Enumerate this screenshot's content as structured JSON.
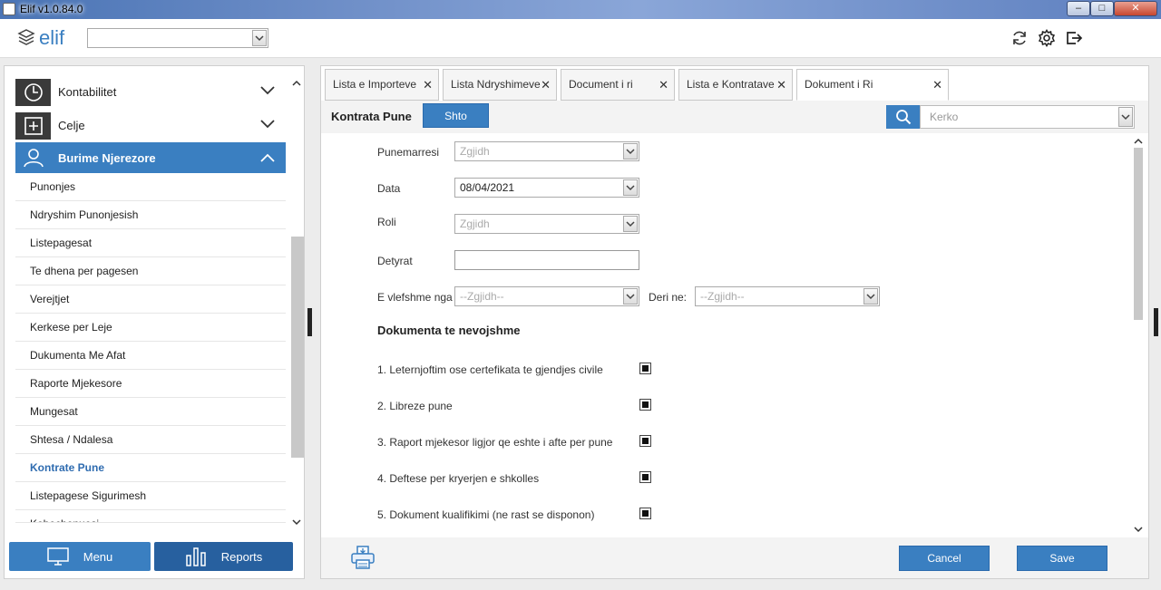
{
  "window": {
    "title": "Elif v1.0.84.0",
    "min": "–",
    "max": "□",
    "close": "✕"
  },
  "header": {
    "logo_text": "elif",
    "company_select": ""
  },
  "sidebar": {
    "groups": [
      {
        "label": "Kontabilitet",
        "icon": "clock-icon",
        "expanded": false
      },
      {
        "label": "Celje",
        "icon": "plus-box-icon",
        "expanded": false
      },
      {
        "label": "Burime Njerezore",
        "icon": "user-icon",
        "expanded": true
      }
    ],
    "items": [
      "Punonjes",
      "Ndryshim Punonjesish",
      "Listepagesat",
      "Te dhena per pagesen",
      "Verejtjet",
      "Kerkese per Leje",
      "Dukumenta Me Afat",
      "Raporte Mjekesore",
      "Mungesat",
      "Shtesa / Ndalesa",
      "Kontrate Pune",
      "Listepagese Sigurimesh",
      "Kohechenuesi"
    ],
    "current_item": "Kontrate Pune",
    "menu_label": "Menu",
    "reports_label": "Reports"
  },
  "tabs": [
    {
      "label": "Lista e Importeve",
      "active": false
    },
    {
      "label": "Lista Ndryshimeve",
      "active": false
    },
    {
      "label": "Document i ri",
      "active": false
    },
    {
      "label": "Lista e Kontratave",
      "active": false
    },
    {
      "label": "Dokument i Ri",
      "active": true
    }
  ],
  "toolbar": {
    "title": "Kontrata Pune",
    "add_label": "Shto",
    "search_placeholder": "Kerko"
  },
  "form": {
    "employee_label": "Punemarresi",
    "employee_value": "Zgjidh",
    "date_label": "Data",
    "date_value": "08/04/2021",
    "role_label": "Roli",
    "role_value": "Zgjidh",
    "duties_label": "Detyrat",
    "duties_value": "",
    "valid_from_label": "E vlefshme nga",
    "valid_from_value": "--Zgjidh--",
    "valid_to_label": "Deri ne:",
    "valid_to_value": "--Zgjidh--"
  },
  "documents": {
    "title": "Dokumenta te nevojshme",
    "items": [
      {
        "label": "1. Leternjoftim ose certefikata te gjendjes civile",
        "checked": true
      },
      {
        "label": "2. Libreze pune",
        "checked": true
      },
      {
        "label": "3. Raport mjekesor ligjor qe eshte i afte per pune",
        "checked": true
      },
      {
        "label": "4. Deftese per kryerjen e shkolles",
        "checked": true
      },
      {
        "label": "5. Dokument kualifikimi (ne rast se disponon)",
        "checked": true
      }
    ]
  },
  "footer": {
    "cancel_label": "Cancel",
    "save_label": "Save"
  }
}
